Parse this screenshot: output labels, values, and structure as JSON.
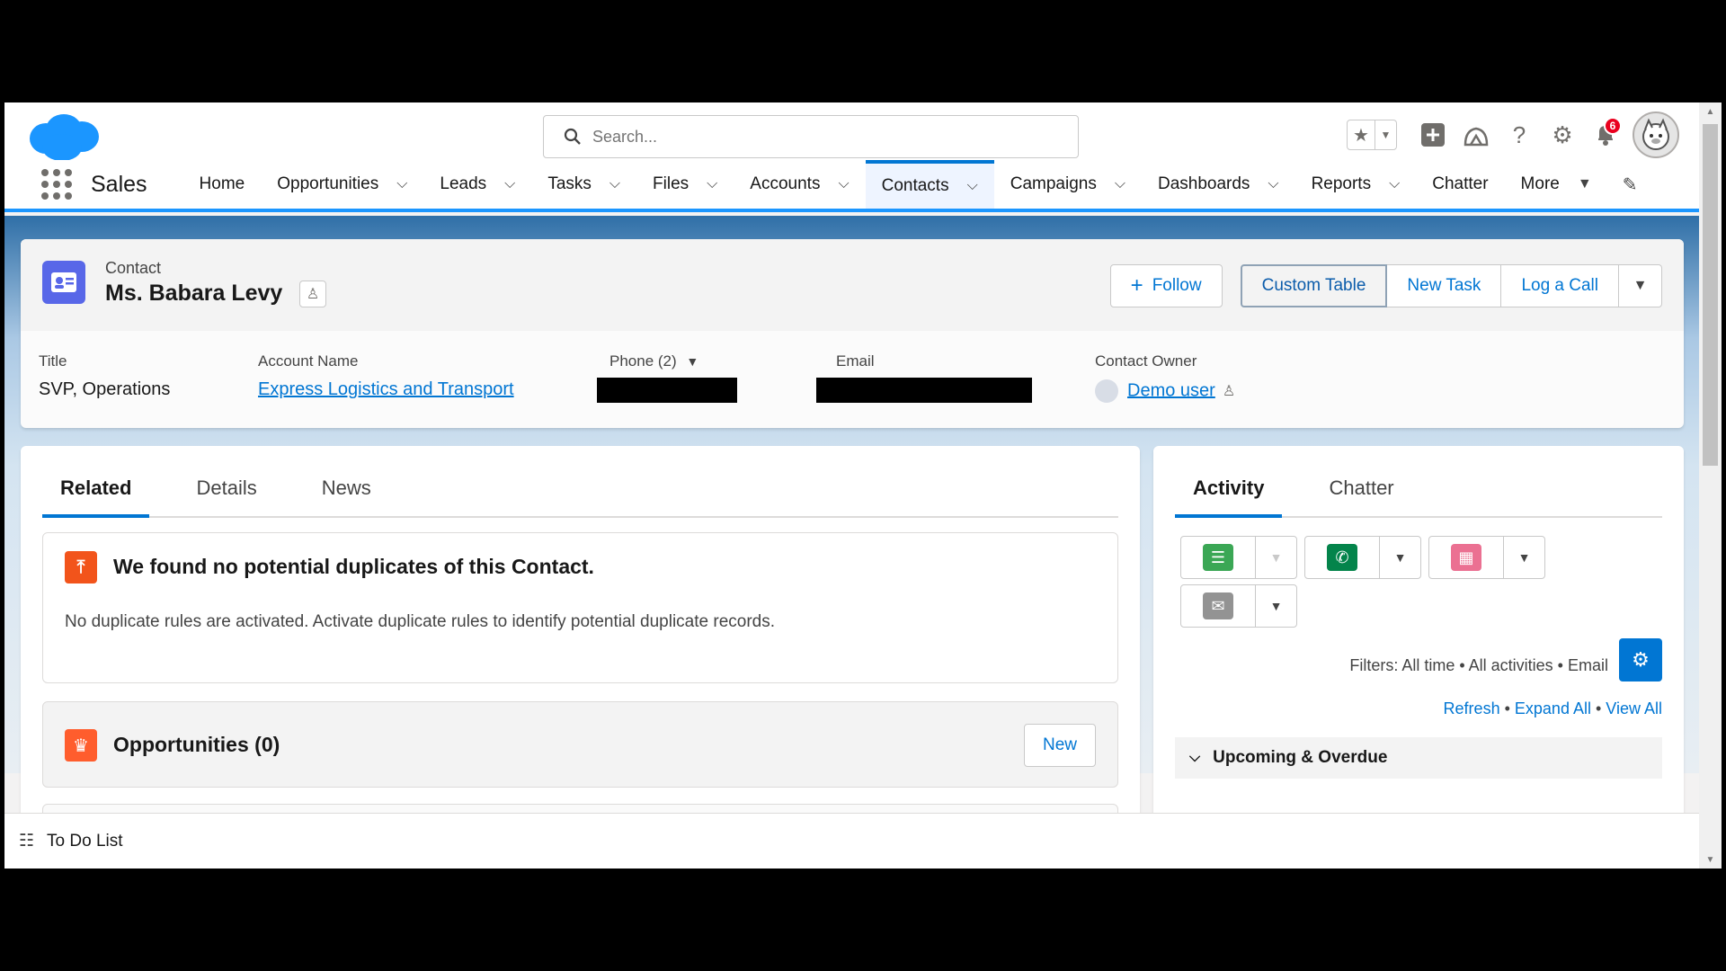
{
  "header": {
    "search_placeholder": "Search...",
    "notification_count": "6"
  },
  "nav": {
    "app_name": "Sales",
    "items": [
      {
        "label": "Home",
        "chevron": false
      },
      {
        "label": "Opportunities",
        "chevron": true
      },
      {
        "label": "Leads",
        "chevron": true
      },
      {
        "label": "Tasks",
        "chevron": true
      },
      {
        "label": "Files",
        "chevron": true
      },
      {
        "label": "Accounts",
        "chevron": true
      },
      {
        "label": "Contacts",
        "chevron": true,
        "active": true
      },
      {
        "label": "Campaigns",
        "chevron": true
      },
      {
        "label": "Dashboards",
        "chevron": true
      },
      {
        "label": "Reports",
        "chevron": true
      },
      {
        "label": "Chatter",
        "chevron": false
      },
      {
        "label": "More",
        "chevron": true
      }
    ]
  },
  "record": {
    "object_type": "Contact",
    "name": "Ms. Babara Levy",
    "buttons": {
      "follow": "Follow",
      "custom_table": "Custom Table",
      "new_task": "New Task",
      "log_call": "Log a Call"
    },
    "fields": {
      "title_label": "Title",
      "title_value": "SVP, Operations",
      "account_label": "Account Name",
      "account_value": "Express Logistics and Transport",
      "phone_label": "Phone (2)",
      "email_label": "Email",
      "owner_label": "Contact Owner",
      "owner_value": "Demo user"
    }
  },
  "left_tabs": [
    "Related",
    "Details",
    "News"
  ],
  "duplicates": {
    "title": "We found no potential duplicates of this Contact.",
    "text": "No duplicate rules are activated. Activate duplicate rules to identify potential duplicate records."
  },
  "opportunities": {
    "title": "Opportunities (0)",
    "new_label": "New"
  },
  "right_tabs": [
    "Activity",
    "Chatter"
  ],
  "activity": {
    "filters": "Filters: All time • All activities • Email",
    "refresh": "Refresh",
    "expand_all": "Expand All",
    "view_all": "View All",
    "upcoming": "Upcoming & Overdue"
  },
  "utility": {
    "todo": "To Do List"
  },
  "colors": {
    "brand": "#0176d3",
    "contact_icon": "#5867e8",
    "task_icon": "#3ba755",
    "call_icon": "#04844b",
    "event_icon": "#eb7092",
    "email_icon": "#939393"
  }
}
